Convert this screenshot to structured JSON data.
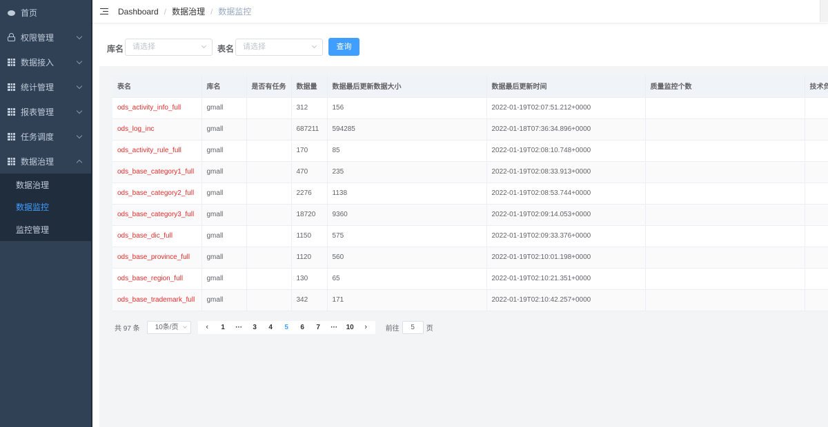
{
  "sidebar": {
    "items": [
      {
        "label": "首页",
        "icon": "dashboard-icon"
      },
      {
        "label": "权限管理",
        "icon": "lock-icon"
      },
      {
        "label": "数据接入",
        "icon": "grid-icon"
      },
      {
        "label": "统计管理",
        "icon": "grid-icon"
      },
      {
        "label": "报表管理",
        "icon": "grid-icon"
      },
      {
        "label": "任务调度",
        "icon": "grid-icon"
      },
      {
        "label": "数据治理",
        "icon": "grid-icon"
      }
    ],
    "submenu": [
      {
        "label": "数据治理"
      },
      {
        "label": "数据监控"
      },
      {
        "label": "监控管理"
      }
    ]
  },
  "breadcrumb": {
    "home": "Dashboard",
    "parent": "数据治理",
    "current": "数据监控"
  },
  "filter": {
    "db_label": "库名",
    "db_placeholder": "请选择",
    "table_label": "表名",
    "table_placeholder": "请选择",
    "query_button": "查询"
  },
  "table": {
    "columns": [
      "表名",
      "库名",
      "是否有任务",
      "数据量",
      "数据最后更新数据大小",
      "数据最后更新时间",
      "质量监控个数",
      "技术负"
    ],
    "rows": [
      [
        "ods_activity_info_full",
        "gmall",
        "",
        "312",
        "156",
        "2022-01-19T02:07:51.212+0000",
        "",
        ""
      ],
      [
        "ods_log_inc",
        "gmall",
        "",
        "687211",
        "594285",
        "2022-01-18T07:36:34.896+0000",
        "",
        ""
      ],
      [
        "ods_activity_rule_full",
        "gmall",
        "",
        "170",
        "85",
        "2022-01-19T02:08:10.748+0000",
        "",
        ""
      ],
      [
        "ods_base_category1_full",
        "gmall",
        "",
        "470",
        "235",
        "2022-01-19T02:08:33.913+0000",
        "",
        ""
      ],
      [
        "ods_base_category2_full",
        "gmall",
        "",
        "2276",
        "1138",
        "2022-01-19T02:08:53.744+0000",
        "",
        ""
      ],
      [
        "ods_base_category3_full",
        "gmall",
        "",
        "18720",
        "9360",
        "2022-01-19T02:09:14.053+0000",
        "",
        ""
      ],
      [
        "ods_base_dic_full",
        "gmall",
        "",
        "1150",
        "575",
        "2022-01-19T02:09:33.376+0000",
        "",
        ""
      ],
      [
        "ods_base_province_full",
        "gmall",
        "",
        "1120",
        "560",
        "2022-01-19T02:10:01.198+0000",
        "",
        ""
      ],
      [
        "ods_base_region_full",
        "gmall",
        "",
        "130",
        "65",
        "2022-01-19T02:10:21.351+0000",
        "",
        ""
      ],
      [
        "ods_base_trademark_full",
        "gmall",
        "",
        "342",
        "171",
        "2022-01-19T02:10:42.257+0000",
        "",
        ""
      ]
    ]
  },
  "pagination": {
    "total_text": "共 97 条",
    "page_size": "10条/页",
    "pages": [
      "1",
      "···",
      "3",
      "4",
      "5",
      "6",
      "7",
      "···",
      "10"
    ],
    "current": "5",
    "goto_label": "前往",
    "goto_value": "5",
    "goto_suffix": "页"
  },
  "colors": {
    "accent": "#409eff",
    "sidebar_bg": "#304156",
    "link_red": "#e12b2b"
  }
}
